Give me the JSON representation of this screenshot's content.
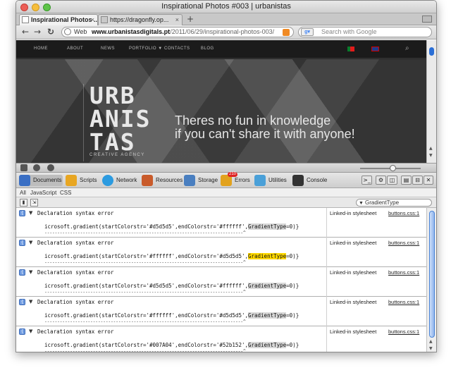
{
  "window": {
    "title": "Inspirational Photos #003 | urbanistas"
  },
  "tabs": [
    {
      "label": "Inspirational Photos ...",
      "close": "×"
    },
    {
      "label": "https://dragonfly.op...",
      "close": "×"
    }
  ],
  "nav": {
    "back": "←",
    "forward": "→",
    "reload": "↻",
    "url_prefix": "Web",
    "url_host": "www.urbanistasdigitals.pt",
    "url_path": "/2011/06/29/inspirational-photos-003/",
    "search_placeholder": "Search with Google",
    "new_tab": "+"
  },
  "site": {
    "nav_items": [
      "HOME",
      "ABOUT",
      "NEWS",
      "PORTFOLIO ▼",
      "CONTACTS",
      "BLOG"
    ],
    "logo_lines": [
      "URB",
      "ANIS",
      "TAS"
    ],
    "logo_tagline": "CREATIVE AGENCY",
    "slogan_line1": "Theres no fun in knowledge",
    "slogan_line2": "if you can't share it with anyone!"
  },
  "devtools": {
    "panels": [
      {
        "label": "Documents",
        "color": "#3a6fc4"
      },
      {
        "label": "Scripts",
        "color": "#e8a622"
      },
      {
        "label": "Network",
        "color": "#2c9be0"
      },
      {
        "label": "Resources",
        "color": "#c95b2b"
      },
      {
        "label": "Storage",
        "color": "#4a7fc0"
      },
      {
        "label": "Errors",
        "color": "#e2a21e",
        "badge": "210"
      },
      {
        "label": "Utilities",
        "color": "#4aa0d8"
      },
      {
        "label": "Console",
        "color": "#333333"
      }
    ],
    "subtabs": [
      "All",
      "JavaScript",
      "CSS"
    ],
    "filter_value": "GradientType",
    "messages": [
      {
        "title": "Declaration syntax error",
        "code_pre": "icrosoft.gradient(startColorstr='#d5d5d5',endColorstr='#ffffff',",
        "code_hl": "GradientType",
        "code_post": "=0)}",
        "highlight_active": false,
        "source": "Linked-in stylesheet",
        "file": "buttons.css:1"
      },
      {
        "title": "Declaration syntax error",
        "code_pre": "icrosoft.gradient(startColorstr='#ffffff',endColorstr='#d5d5d5',",
        "code_hl": "GradientType",
        "code_post": "=0)}",
        "highlight_active": true,
        "source": "Linked-in stylesheet",
        "file": "buttons.css:1"
      },
      {
        "title": "Declaration syntax error",
        "code_pre": "icrosoft.gradient(startColorstr='#d5d5d5',endColorstr='#ffffff',",
        "code_hl": "GradientType",
        "code_post": "=0)}",
        "highlight_active": false,
        "source": "Linked-in stylesheet",
        "file": "buttons.css:1"
      },
      {
        "title": "Declaration syntax error",
        "code_pre": "icrosoft.gradient(startColorstr='#ffffff',endColorstr='#d5d5d5',",
        "code_hl": "GradientType",
        "code_post": "=0)}",
        "highlight_active": false,
        "source": "Linked-in stylesheet",
        "file": "buttons.css:1"
      },
      {
        "title": "Declaration syntax error",
        "code_pre": "icrosoft.gradient(startColorstr='#007A04',endColorstr='#52b152',",
        "code_hl": "GradientType",
        "code_post": "=0)}",
        "highlight_active": false,
        "source": "Linked-in stylesheet",
        "file": "buttons.css:1"
      }
    ]
  }
}
